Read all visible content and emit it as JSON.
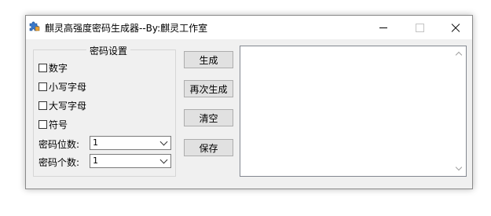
{
  "window": {
    "title": "麒灵高强度密码生成器--By:麒灵工作室",
    "icon": "puzzle-app-icon",
    "controls": {
      "minimize": "minimize-icon",
      "maximize": "maximize-icon",
      "close": "close-icon"
    }
  },
  "settings": {
    "group_title": "密码设置",
    "checkboxes": [
      {
        "label": "数字",
        "checked": false
      },
      {
        "label": "小写字母",
        "checked": false
      },
      {
        "label": "大写字母",
        "checked": false
      },
      {
        "label": "符号",
        "checked": false
      }
    ],
    "length_label": "密码位数:",
    "length_value": "1",
    "count_label": "密码个数:",
    "count_value": "1"
  },
  "buttons": {
    "generate": "生成",
    "regenerate": "再次生成",
    "clear": "清空",
    "save": "保存"
  },
  "output": {
    "text": ""
  }
}
